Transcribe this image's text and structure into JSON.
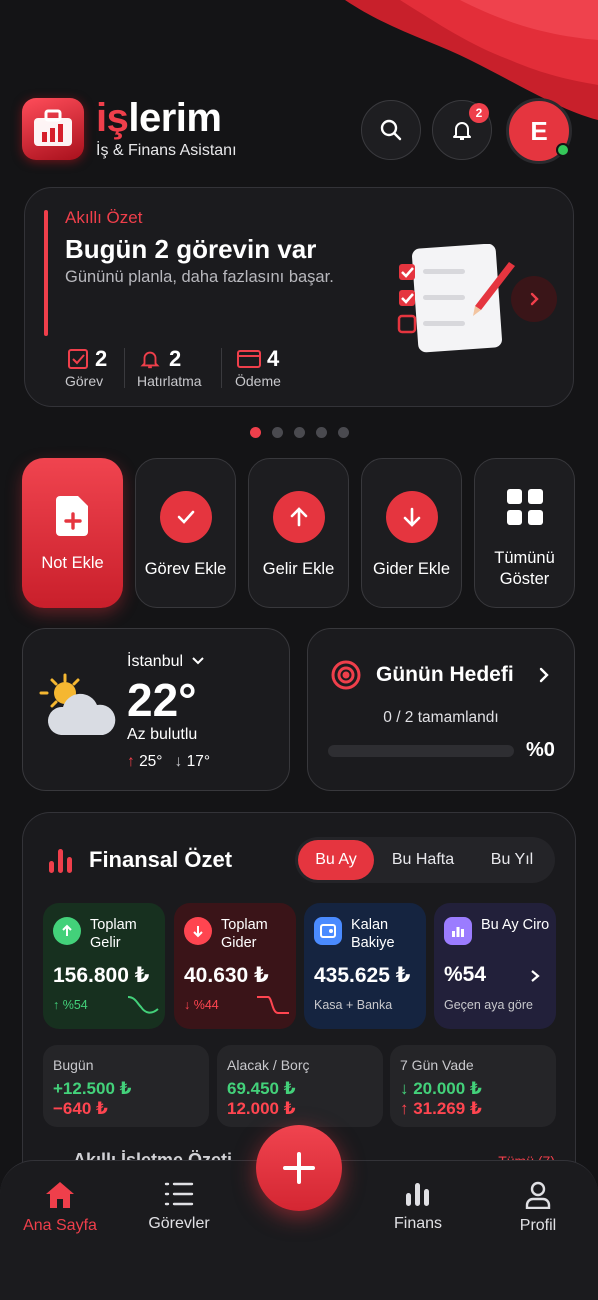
{
  "app": {
    "brand_prefix": "iş",
    "brand_suffix": "lerim",
    "subtitle": "İş & Finans Asistanı",
    "notification_count": "2",
    "avatar_initial": "E"
  },
  "summary": {
    "tag": "Akıllı Özet",
    "title": "Bugün 2 görevin var",
    "subtitle": "Gününü planla, daha fazlasını başar.",
    "stats": [
      {
        "value": "2",
        "label": "Görev",
        "icon": "checkbox-icon"
      },
      {
        "value": "2",
        "label": "Hatırlatma",
        "icon": "bell-icon"
      },
      {
        "value": "4",
        "label": "Ödeme",
        "icon": "card-icon"
      }
    ],
    "carousel_pages": 5,
    "carousel_active": 0
  },
  "quick_actions": [
    {
      "label": "Not Ekle",
      "icon": "note-add-icon"
    },
    {
      "label": "Görev Ekle",
      "icon": "check-icon"
    },
    {
      "label": "Gelir Ekle",
      "icon": "arrow-up-icon"
    },
    {
      "label": "Gider Ekle",
      "icon": "arrow-down-icon"
    },
    {
      "label": "Tümünü Göster",
      "icon": "grid-icon"
    }
  ],
  "weather": {
    "city": "İstanbul",
    "temperature": "22°",
    "description": "Az bulutlu",
    "high": "25°",
    "low": "17°"
  },
  "goal": {
    "title": "Günün Hedefi",
    "progress_text": "0 / 2 tamamlandı",
    "percent_text": "%0",
    "progress": 0
  },
  "finance": {
    "title": "Finansal Özet",
    "periods": [
      "Bu Ay",
      "Bu Hafta",
      "Bu Yıl"
    ],
    "active_period": "Bu Ay",
    "cards": [
      {
        "title": "Toplam Gelir",
        "value": "156.800 ₺",
        "sub": "↑ %54",
        "color": "#43d17a"
      },
      {
        "title": "Toplam Gider",
        "value": "40.630 ₺",
        "sub": "↓ %44",
        "color": "#ff4550"
      },
      {
        "title": "Kalan Bakiye",
        "value": "435.625 ₺",
        "sub": "Kasa + Banka",
        "color": "#4a8bff"
      },
      {
        "title": "Bu Ay Ciro",
        "value": "%54",
        "sub": "Geçen aya göre",
        "color": "#9b7cff"
      }
    ],
    "mini_cards": [
      {
        "title": "Bugün",
        "a": "+12.500 ₺",
        "b": "−640 ₺"
      },
      {
        "title": "Alacak / Borç",
        "a": "69.450 ₺",
        "b": "12.000 ₺"
      },
      {
        "title": "7 Gün Vade",
        "a": "↓ 20.000 ₺",
        "b": "↑ 31.269 ₺"
      }
    ],
    "next_section": "Akıllı İşletme Özeti",
    "see_all": "Tümü (7)"
  },
  "nav": [
    {
      "label": "Ana Sayfa",
      "icon": "home-icon",
      "active": true
    },
    {
      "label": "Görevler",
      "icon": "list-icon",
      "active": false
    },
    {
      "label": "Finans",
      "icon": "bar-chart-icon",
      "active": false
    },
    {
      "label": "Profil",
      "icon": "user-icon",
      "active": false
    }
  ]
}
